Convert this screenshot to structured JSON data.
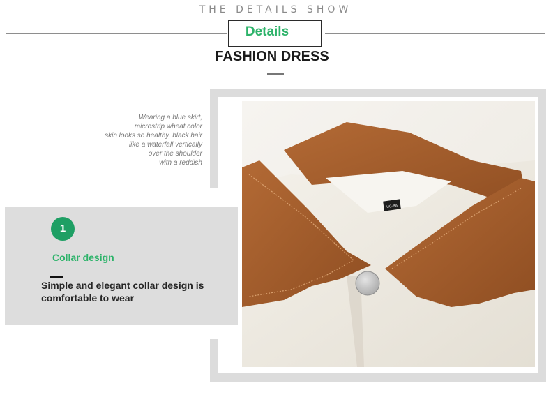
{
  "header": {
    "top_title": "THE DETAILS SHOW",
    "badge": "Details",
    "headline": "FASHION DRESS"
  },
  "description_lines": [
    "Wearing a blue skirt,",
    "microstrip wheat color",
    "skin looks so healthy, black hair",
    "like a waterfall vertically",
    "over the shoulder",
    "with a reddish"
  ],
  "feature": {
    "number": "1",
    "title": "Collar design",
    "description": "Simple and elegant collar design is comfortable to wear"
  },
  "photo": {
    "label_tag_text": "UG·BA"
  },
  "colors": {
    "accent_green": "#2db36a",
    "circle_green": "#1e9f64",
    "collar_brown": "#a9602e",
    "shirt_cream": "#f1ede4",
    "frame_grey": "#dcdcdc",
    "panel_grey": "#dddddd"
  }
}
